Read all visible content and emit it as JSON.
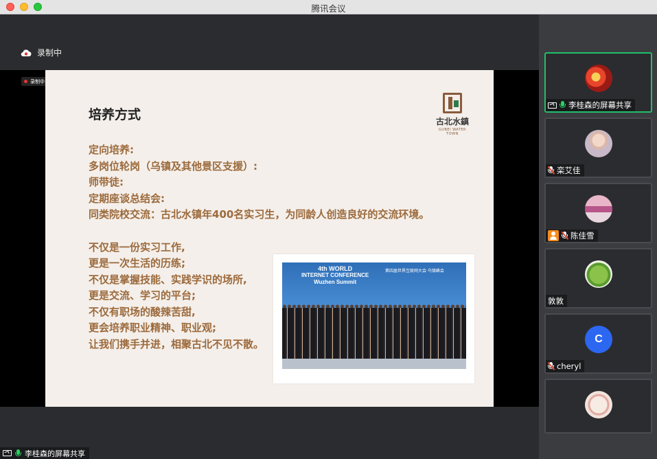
{
  "window": {
    "title": "腾讯会议"
  },
  "recording": {
    "label": "录制中",
    "mini_label": "录制中"
  },
  "slide": {
    "title": "培养方式",
    "logo_cn": "古北水鎮",
    "logo_en": "GUBEI WATER TOWN",
    "lines_a": [
      "定向培养:",
      "多岗位轮岗（乌镇及其他景区支援）:",
      "师带徒:",
      "定期座谈总结会:",
      "同类院校交流：古北水镇年400名实习生，为同龄人创造良好的交流环境。"
    ],
    "lines_b": [
      "不仅是一份实习工作,",
      "更是一次生活的历练;",
      "不仅是掌握技能、实践学识的场所,",
      "更是交流、学习的平台;",
      "不仅有职场的酸辣苦甜,",
      "更会培养职业精神、职业观;",
      "让我们携手并进，相聚古北不见不散。"
    ],
    "photo": {
      "banner_line1": "4th WORLD",
      "banner_line2": "INTERNET CONFERENCE",
      "banner_line3": "Wuzhen Summit",
      "banner_cn": "第四届世界互联网大会·乌镇峰会"
    }
  },
  "share_label": "李桂森的屏幕共享",
  "participants": [
    {
      "name": "李桂森的屏幕共享",
      "mic": "on",
      "sharing": true,
      "avatar": "photo-red"
    },
    {
      "name": "栾艾佳",
      "mic": "muted",
      "avatar": "photo-girl"
    },
    {
      "name": "陈佳雪",
      "mic": "muted",
      "host_badge": true,
      "avatar": "photo-landscape"
    },
    {
      "name": "敦敦",
      "mic": "none",
      "avatar": "photo-frog"
    },
    {
      "name": "cheryl",
      "mic": "muted",
      "avatar": "letter",
      "letter": "C"
    },
    {
      "name": "",
      "mic": "none",
      "avatar": "photo-cartoon"
    }
  ],
  "colors": {
    "accent_active": "#1fc16b",
    "slide_text": "#9c6a3c",
    "avatar_c": "#2c67f2"
  }
}
